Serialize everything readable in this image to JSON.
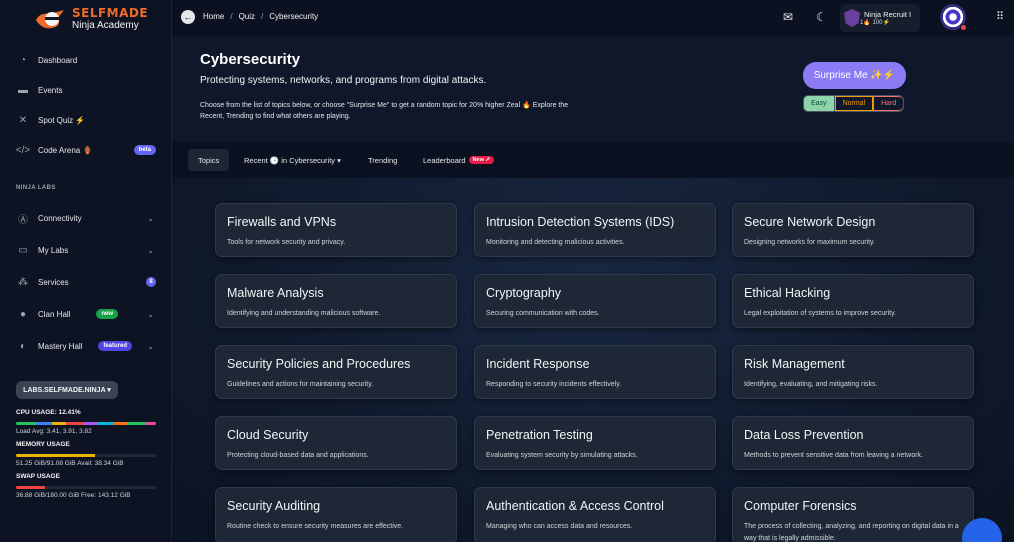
{
  "brand": {
    "name": "SELFMADE",
    "subtitle": "Ninja Academy"
  },
  "sidebar": {
    "items": [
      {
        "label": "Dashboard",
        "icon": "dashboard-icon"
      },
      {
        "label": "Events",
        "icon": "calendar-icon"
      },
      {
        "label": "Spot Quiz ⚡",
        "icon": "tools-icon"
      },
      {
        "label": "Code Arena 🏺",
        "icon": "code-icon",
        "badge": "beta"
      }
    ],
    "section_label": "NINJA LABS",
    "lab_items": [
      {
        "label": "Connectivity",
        "icon": "antenna-icon"
      },
      {
        "label": "My Labs",
        "icon": "box-icon"
      },
      {
        "label": "Services",
        "icon": "services-icon",
        "badge": "8"
      },
      {
        "label": "Clan Hall",
        "icon": "users-icon",
        "badge": "new"
      },
      {
        "label": "Mastery Hall",
        "icon": "shield-icon",
        "badge": "featured"
      }
    ],
    "labs_button": "LABS.SELFMADE.NINJA ▾",
    "stats": {
      "cpu_label": "CPU USAGE: 12.41%",
      "cpu_fraction": 0.1241,
      "load_avg": "Load Avg: 3.41, 3.91, 3.82",
      "memory_label": "MEMORY USAGE",
      "memory_text": "51.25 GiB/91.08 GiB Avail: 38.34 GiB",
      "memory_fraction": 0.563,
      "swap_label": "SWAP USAGE",
      "swap_text": "36.88 GiB/180.00 GiB Free: 143.12 GiB",
      "swap_fraction": 0.205
    }
  },
  "breadcrumb": [
    "Home",
    "Quiz",
    "Cybersecurity"
  ],
  "profile": {
    "name": "Ninja Recruit I",
    "stats": "1🔥 100⚡"
  },
  "header": {
    "title": "Cybersecurity",
    "subtitle": "Protecting systems, networks, and programs from digital attacks.",
    "description": "Choose from the list of topics below, or choose \"Surprise Me\" to get a random topic for 20% higher Zeal 🔥 Explore the Recent, Trending to find what others are playing.",
    "surprise_label": "Surprise Me ✨⚡",
    "difficulty": [
      "Easy",
      "Normal",
      "Hard"
    ]
  },
  "tabs": [
    {
      "label": "Topics"
    },
    {
      "label": "Recent 🕒 in Cybersecurity ▾"
    },
    {
      "label": "Trending"
    },
    {
      "label": "Leaderboard",
      "badge": "New ↗"
    }
  ],
  "topics": [
    {
      "title": "Firewalls and VPNs",
      "desc": "Tools for network security and privacy."
    },
    {
      "title": "Intrusion Detection Systems (IDS)",
      "desc": "Monitoring and detecting malicious activities."
    },
    {
      "title": "Secure Network Design",
      "desc": "Designing networks for maximum security."
    },
    {
      "title": "Malware Analysis",
      "desc": "Identifying and understanding malicious software."
    },
    {
      "title": "Cryptography",
      "desc": "Securing communication with codes."
    },
    {
      "title": "Ethical Hacking",
      "desc": "Legal exploitation of systems to improve security."
    },
    {
      "title": "Security Policies and Procedures",
      "desc": "Guidelines and actions for maintaining security."
    },
    {
      "title": "Incident Response",
      "desc": "Responding to security incidents effectively."
    },
    {
      "title": "Risk Management",
      "desc": "Identifying, evaluating, and mitigating risks."
    },
    {
      "title": "Cloud Security",
      "desc": "Protecting cloud-based data and applications."
    },
    {
      "title": "Penetration Testing",
      "desc": "Evaluating system security by simulating attacks."
    },
    {
      "title": "Data Loss Prevention",
      "desc": "Methods to prevent sensitive data from leaving a network."
    },
    {
      "title": "Security Auditing",
      "desc": "Routine check to ensure security measures are effective."
    },
    {
      "title": "Authentication & Access Control",
      "desc": "Managing who can access data and resources."
    },
    {
      "title": "Computer Forensics",
      "desc": "The process of collecting, analyzing, and reporting on digital data in a way that is legally admissible."
    }
  ]
}
